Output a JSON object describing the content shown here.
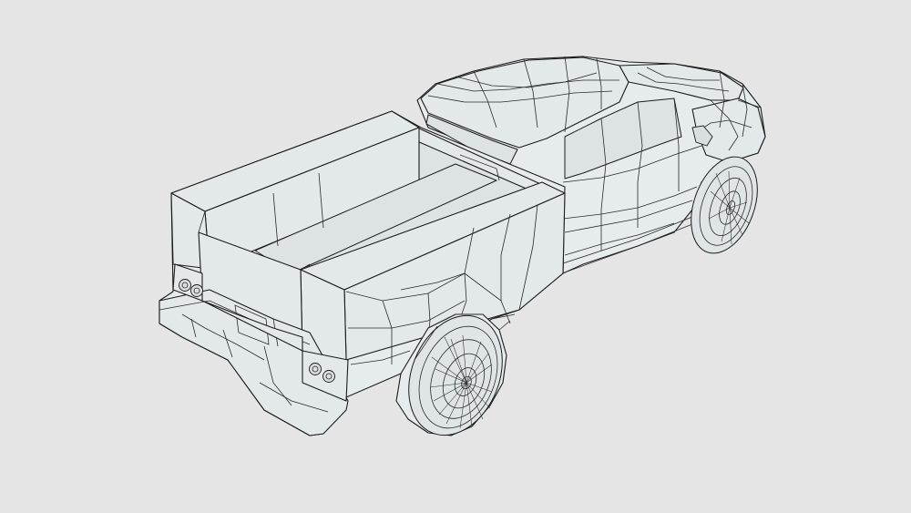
{
  "scene": {
    "background_color": "#e5e5e5",
    "line_color": "#1c1c1c",
    "surface_color": "#e6ebeb"
  }
}
